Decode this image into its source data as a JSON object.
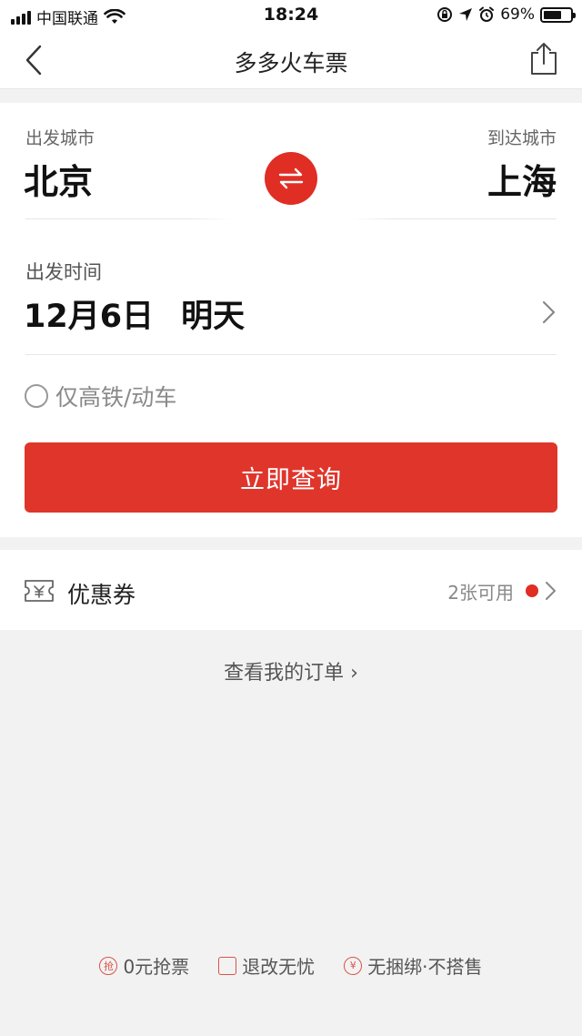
{
  "status_bar": {
    "carrier": "中国联通",
    "time": "18:24",
    "battery": "69%",
    "battery_level": 0.69
  },
  "nav": {
    "title": "多多火车票",
    "icons": {
      "back": "chevron-left-icon",
      "share": "share-icon"
    }
  },
  "search": {
    "from_label": "出发城市",
    "from_city": "北京",
    "to_label": "到达城市",
    "to_city": "上海",
    "date_label": "出发时间",
    "date": "12月6日",
    "day": "明天",
    "high_speed_label": "仅高铁/动车",
    "search_button": "立即查询"
  },
  "coupon": {
    "label": "优惠券",
    "count_text": "2张可用"
  },
  "orders_link": "查看我的订单 ›",
  "features": [
    {
      "icon_text": "抢",
      "label": "0元抢票"
    },
    {
      "icon_text": "",
      "label": "退改无忧"
    },
    {
      "icon_text": "¥",
      "label": "无捆绑·不搭售"
    }
  ],
  "colors": {
    "accent": "#e02e24",
    "button": "#e0352b",
    "background": "#f2f2f2"
  }
}
